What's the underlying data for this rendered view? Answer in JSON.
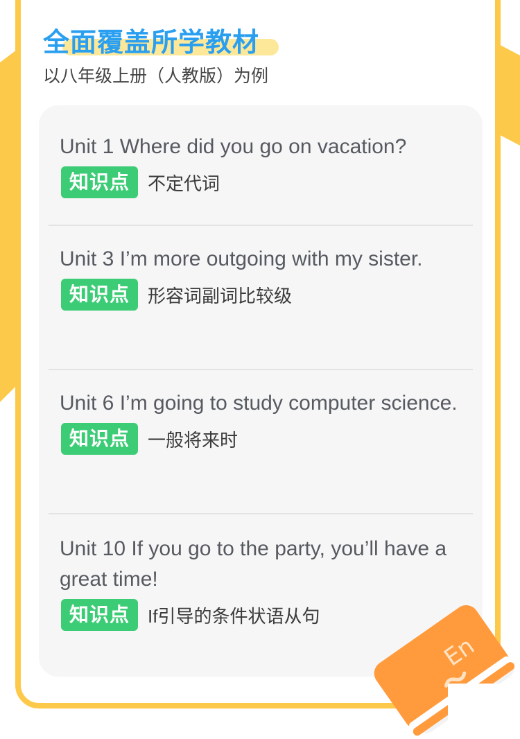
{
  "header": {
    "title": "全面覆盖所学教材",
    "subtitle": "以八年级上册（人教版）为例"
  },
  "badge_label": "知识点",
  "units": [
    {
      "title": "Unit 1 Where did you go on vacation?",
      "knowledge_point": "不定代词"
    },
    {
      "title": "Unit 3 I’m more outgoing with my sister.",
      "knowledge_point": "形容词副词比较级"
    },
    {
      "title": "Unit 6 I’m going to study computer science.",
      "knowledge_point": "一般将来时"
    },
    {
      "title": "Unit 10 If you go to the party, you’ll have a great time!",
      "knowledge_point": "If引导的条件状语从句"
    }
  ],
  "icons": {
    "book": "english-book-icon",
    "book_label": "En"
  },
  "colors": {
    "accent_yellow": "#fdc94a",
    "title_blue": "#2a9ff0",
    "badge_green": "#3dcc76",
    "book_orange": "#ff9b3d"
  }
}
